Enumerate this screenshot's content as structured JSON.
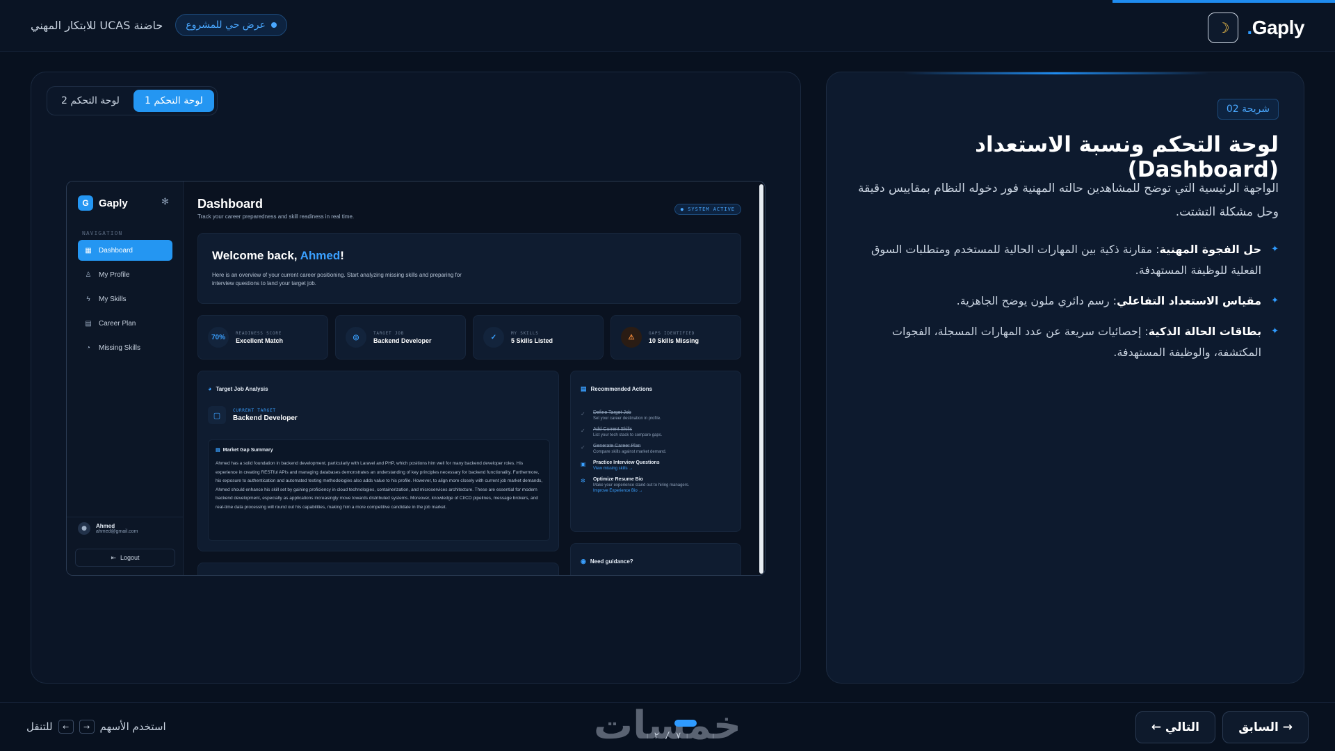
{
  "header": {
    "brand": "Gaply",
    "brand_dot": ".",
    "theme_icon": "moon-icon",
    "incubator": "حاضنة UCAS للابتكار المهني",
    "live_demo": "عرض حي للمشروع"
  },
  "left": {
    "tabs": [
      {
        "label": "لوحة التحكم 1",
        "active": true
      },
      {
        "label": "لوحة التحكم 2",
        "active": false
      }
    ]
  },
  "mock": {
    "logo_letter": "G",
    "logo_name": "Gaply",
    "nav_label": "NAVIGATION",
    "nav": [
      {
        "label": "Dashboard",
        "icon": "grid-icon",
        "active": true
      },
      {
        "label": "My Profile",
        "icon": "user-icon",
        "active": false
      },
      {
        "label": "My Skills",
        "icon": "bolt-icon",
        "active": false
      },
      {
        "label": "Career Plan",
        "icon": "plan-icon",
        "active": false
      },
      {
        "label": "Missing Skills",
        "icon": "target-icon",
        "active": false
      }
    ],
    "user": {
      "name": "Ahmed",
      "email": "ahmed@gmail.com"
    },
    "logout": "Logout",
    "title": "Dashboard",
    "subtitle": "Track your career preparedness and skill readiness in real time.",
    "system_badge": "● SYSTEM ACTIVE",
    "welcome_prefix": "Welcome back, ",
    "welcome_name": "Ahmed",
    "welcome_suffix": "!",
    "welcome_text": "Here is an overview of your current career positioning. Start analyzing missing skills and preparing for interview questions to land your target job.",
    "stats": [
      {
        "label": "READINESS SCORE",
        "value": "Excellent Match",
        "icon_text": "70%"
      },
      {
        "label": "TARGET JOB",
        "value": "Backend Developer",
        "icon_text": "◎"
      },
      {
        "label": "MY SKILLS",
        "value": "5 Skills Listed",
        "icon_text": "✓"
      },
      {
        "label": "GAPS IDENTIFIED",
        "value": "10 Skills Missing",
        "icon_text": "⚠"
      }
    ],
    "analysis_title": "Target Job Analysis",
    "current_target_label": "CURRENT TARGET",
    "current_target_value": "Backend Developer",
    "gap_title": "Market Gap Summary",
    "gap_text": "Ahmed has a solid foundation in backend development, particularly with Laravel and PHP, which positions him well for many backend developer roles. His experience in creating RESTful APIs and managing databases demonstrates an understanding of key principles necessary for backend functionality. Furthermore, his exposure to authentication and automated testing methodologies also adds value to his profile. However, to align more closely with current job market demands, Ahmed should enhance his skill set by gaining proficiency in cloud technologies, containerization, and microservices architecture. These are essential for modern backend development, especially as applications increasingly move towards distributed systems. Moreover, knowledge of CI/CD pipelines, message brokers, and real-time data processing will round out his capabilities, making him a more competitive candidate in the job market.",
    "actions_title": "Recommended Actions",
    "actions": [
      {
        "title": "Define Target Job",
        "sub": "Set your career destination in profile.",
        "link": "",
        "done": true
      },
      {
        "title": "Add Current Skills",
        "sub": "List your tech stack to compare gaps.",
        "link": "",
        "done": true
      },
      {
        "title": "Generate Career Plan",
        "sub": "Compare skills against market demand.",
        "link": "",
        "done": true
      },
      {
        "title": "Practice Interview Questions",
        "sub": "",
        "link": "View missing skills →",
        "done": false
      },
      {
        "title": "Optimize Resume Bio",
        "sub": "Make your experience stand out to hiring managers.",
        "link": "Improve Experience Bio →",
        "done": false
      }
    ],
    "guidance_title": "Need guidance?"
  },
  "slide": {
    "tag": "شريحة 02",
    "title": "لوحة التحكم ونسبة الاستعداد (Dashboard)",
    "description": "الواجهة الرئيسية التي توضح للمشاهدين حالته المهنية فور دخوله النظام بمقاييس دقيقة وحل مشكلة التشتت.",
    "bullets": [
      {
        "bold": "حل الفجوة المهنية",
        "text": ": مقارنة ذكية بين المهارات الحالية للمستخدم ومتطلبات السوق الفعلية للوظيفة المستهدفة."
      },
      {
        "bold": "مقياس الاستعداد التفاعلي",
        "text": ": رسم دائري ملون يوضح الجاهزية."
      },
      {
        "bold": "بطاقات الحالة الذكية",
        "text": ": إحصائيات سريعة عن عدد المهارات المسجلة، الفجوات المكتشفة، والوظيفة المستهدفة."
      }
    ]
  },
  "footer": {
    "hint_prefix": "استخدم الأسهم",
    "hint_suffix": "للتنقل",
    "key_right": "→",
    "key_left": "←",
    "counter": "٧ / ٢",
    "watermark": "خمسات",
    "next": "التالي ←",
    "prev": "→ السابق"
  },
  "colors": {
    "accent": "#1f8cf0",
    "background": "#08111f",
    "panel": "#0d1a2e"
  }
}
